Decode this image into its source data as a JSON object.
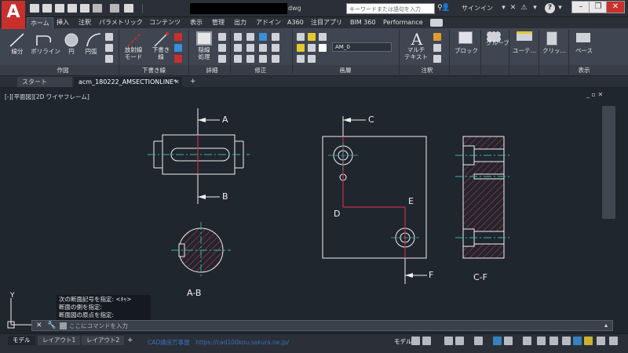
{
  "titlebar": {
    "file_ext": "dwg",
    "search_placeholder": "キーワードまたは語句を入力",
    "signin_label": "サインイン",
    "help_label": "?"
  },
  "ribbon_tabs": [
    "ホーム",
    "挿入",
    "注釈",
    "パラメトリック",
    "コンテンツ",
    "表示",
    "管理",
    "出力",
    "アドイン",
    "A360",
    "注目アプリ",
    "BIM 360",
    "Performance"
  ],
  "ribbon": {
    "draw": {
      "line": "線分",
      "polyline": "ポリライン",
      "circle": "円",
      "arc": "円弧"
    },
    "annot_tools": {
      "section": "放射線",
      "section2": "モード",
      "draft": "下書き",
      "draft2": "線"
    },
    "detail": {
      "label": "隠線",
      "label2": "処理"
    },
    "layer_name": "AM_0",
    "text": {
      "label": "マルチ",
      "label2": "テキスト"
    },
    "block": "ブロック",
    "group": "グループ",
    "utility": "ユーテ…",
    "clipboard": "クリッ…",
    "base": "ベース",
    "panel_titles": [
      "作図",
      "下書き線",
      "詳細",
      "修正",
      "画層",
      "注釈",
      "",
      "",
      "",
      "",
      "表示"
    ]
  },
  "file_tabs": {
    "start": "スタート",
    "active": "acm_180222_AMSECTIONLINE*",
    "plus": "+"
  },
  "viewport": {
    "label": "[-][平面図][2D ワイヤフレーム]",
    "controls": "_ ▫ ✕"
  },
  "drawing": {
    "labels": {
      "A": "A",
      "B": "B",
      "C": "C",
      "D": "D",
      "E": "E",
      "F": "F",
      "ab": "A-B",
      "cf": "C-F"
    },
    "ucs_y": "Y"
  },
  "command": {
    "history": [
      "次の断面記号を指定: <ｷｬ>",
      "断面の側を指定:",
      "断面図の原点を指定:"
    ],
    "placeholder": "ここにコマンドを入力"
  },
  "status": {
    "layout_tabs": [
      "モデル",
      "レイアウト1",
      "レイアウト2"
    ],
    "watermark": "CAD講座万事屋　https://cad100kou.sakura.ne.jp/",
    "model_label": "モデル"
  },
  "colors": {
    "accent": "#c9302c",
    "hatch": "#c0304a",
    "axis": "#33b7a8",
    "lines": "#f0f0f0",
    "background": "#20262e"
  }
}
